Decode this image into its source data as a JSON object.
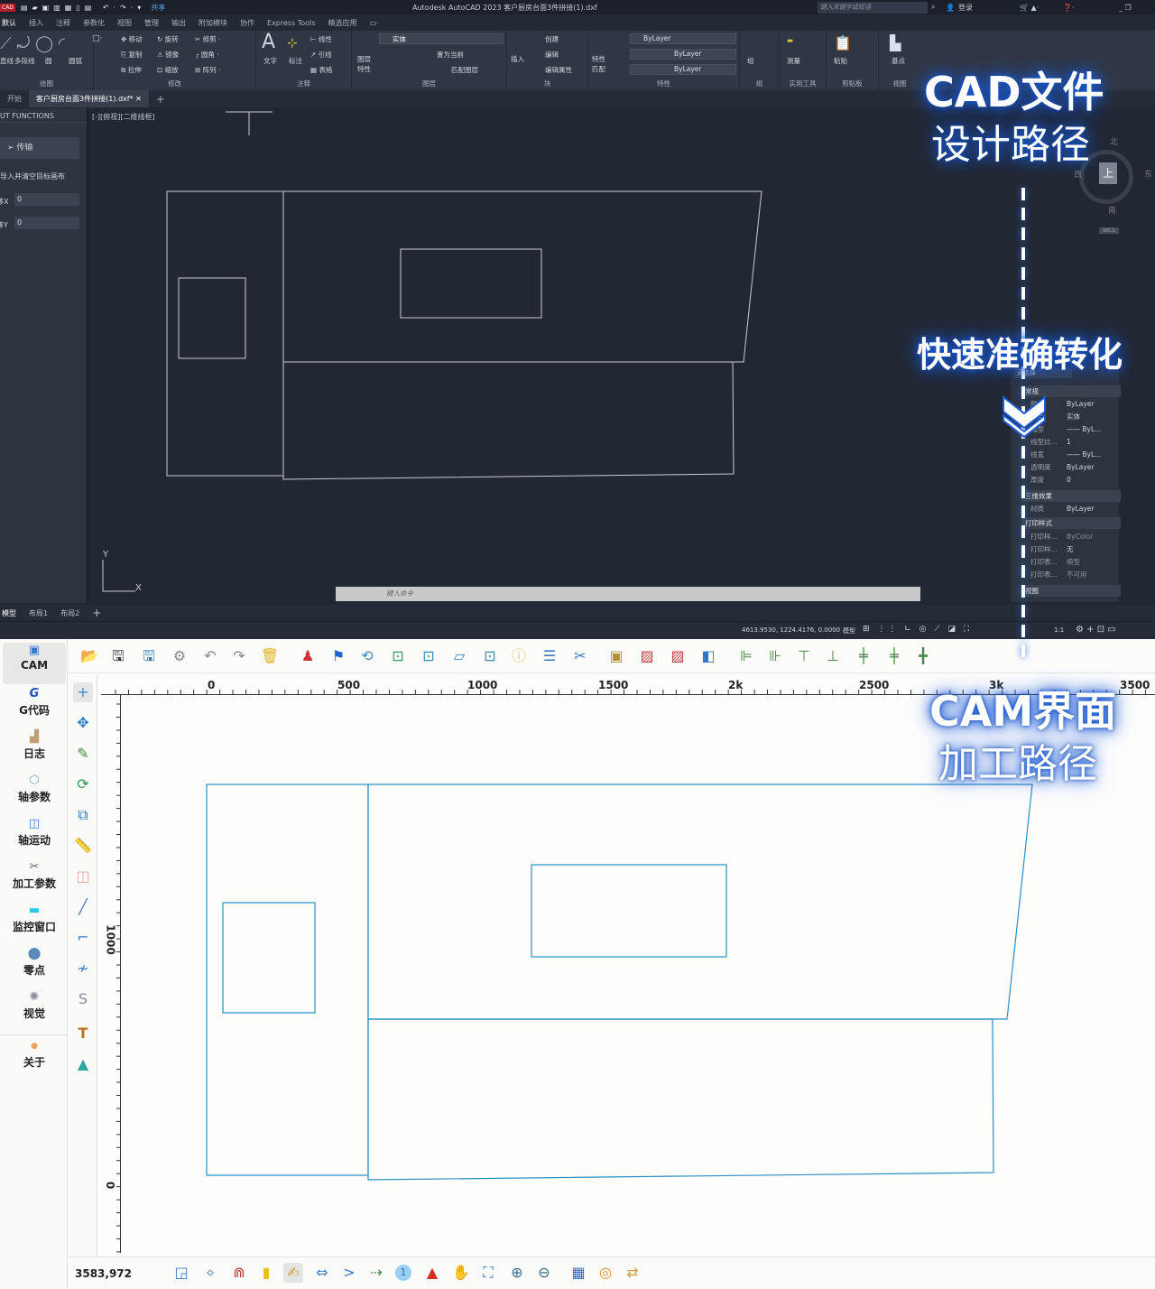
{
  "cad": {
    "app_badge": "CAD",
    "share_label": "共享",
    "window_title": "Autodesk AutoCAD 2023    客户厨房台面3件拼接(1).dxf",
    "search_placeholder": "键入关键字或短语",
    "login_label": "登录",
    "menu_tabs": [
      "默认",
      "插入",
      "注释",
      "参数化",
      "视图",
      "管理",
      "输出",
      "附加模块",
      "协作",
      "Express Tools",
      "精选应用"
    ],
    "ribbon": {
      "draw": {
        "label": "绘图",
        "items": [
          "直线",
          "多段线",
          "圆",
          "圆弧"
        ]
      },
      "modify": {
        "label": "修改",
        "items": [
          "移动",
          "旋转",
          "修剪",
          "复制",
          "镜像",
          "圆角",
          "拉伸",
          "缩放",
          "阵列"
        ]
      },
      "annotation": {
        "label": "注释",
        "items": [
          "文字",
          "标注",
          "线性",
          "引线",
          "表格"
        ]
      },
      "layers": {
        "label": "图层",
        "items": [
          "图层特性",
          "置为当前",
          "匹配图层"
        ],
        "layer_value": "实体"
      },
      "block": {
        "label": "块",
        "items": [
          "插入",
          "创建",
          "编辑",
          "编辑属性"
        ]
      },
      "properties": {
        "label": "特性",
        "items": [
          "特性匹配"
        ],
        "color": "ByLayer",
        "linetype": "ByLayer",
        "lineweight": "ByLayer"
      },
      "groups": {
        "label": "组",
        "items": [
          "组"
        ]
      },
      "utilities": {
        "label": "实用工具",
        "items": [
          "测量"
        ]
      },
      "clipboard": {
        "label": "剪贴板",
        "items": [
          "粘贴"
        ]
      },
      "view": {
        "label": "视图",
        "items": [
          "基点"
        ]
      }
    },
    "doc_tabs": [
      "开始",
      "客户厨房台面3件拼接(1).dxf*"
    ],
    "left_panel": {
      "title": "UT FUNCTIONS",
      "transfer_button": "传输",
      "import_label": "导入并清空目标画布",
      "offset_x_label": "移X",
      "offset_x": "0",
      "offset_y_label": "移Y",
      "offset_y": "0"
    },
    "viewport_label": "[-][俯视][二维线框]",
    "viewcube": {
      "top": "上",
      "north": "北",
      "south": "南",
      "east": "东",
      "west": "西",
      "wcs": "WCS"
    },
    "properties": {
      "selection": "无选择",
      "sections": [
        "常规",
        "三维效果",
        "打印样式",
        "视图"
      ],
      "rows": [
        {
          "label": "颜色",
          "value": "ByLayer"
        },
        {
          "label": "图层",
          "value": "实体"
        },
        {
          "label": "线型",
          "value": "—— ByL..."
        },
        {
          "label": "线型比...",
          "value": "1"
        },
        {
          "label": "线宽",
          "value": "—— ByL..."
        },
        {
          "label": "透明度",
          "value": "ByLayer"
        },
        {
          "label": "厚度",
          "value": "0"
        },
        {
          "label": "材质",
          "value": "ByLayer"
        },
        {
          "label": "打印样...",
          "value": "ByColor"
        },
        {
          "label": "打印样...",
          "value": "无"
        },
        {
          "label": "打印表...",
          "value": "模型"
        },
        {
          "label": "打印表...",
          "value": "不可用"
        }
      ]
    },
    "command_placeholder": "键入命令",
    "layout_tabs": [
      "模型",
      "布局1",
      "布局2"
    ],
    "coordinates": "4613.9530, 1224.4176, 0.0000",
    "model_label": "模型",
    "scale": "1:1"
  },
  "cam": {
    "nav": [
      {
        "label": "CAM",
        "icon": "monitor-icon"
      },
      {
        "label": "G代码",
        "icon": "g-code-icon"
      },
      {
        "label": "日志",
        "icon": "log-icon"
      },
      {
        "label": "轴参数",
        "icon": "axis-params-icon"
      },
      {
        "label": "轴运动",
        "icon": "axis-motion-icon"
      },
      {
        "label": "加工参数",
        "icon": "tools-icon"
      },
      {
        "label": "监控窗口",
        "icon": "monitor-window-icon"
      },
      {
        "label": "零点",
        "icon": "zero-point-icon"
      },
      {
        "label": "视觉",
        "icon": "vision-icon"
      },
      {
        "label": "关于",
        "icon": "info-icon"
      }
    ],
    "ruler_x": [
      "0",
      "500",
      "1000",
      "1500",
      "2k",
      "2500",
      "3k",
      "3500"
    ],
    "ruler_y": [
      "1000",
      "0"
    ],
    "cursor_coords": "3583,972",
    "layer_badge": "1",
    "accent_color": "#2a8fc4"
  },
  "overlay": {
    "cad_title": "CAD文件",
    "cad_subtitle": "设计路径",
    "middle": "快速准确转化",
    "cam_title": "CAM界面",
    "cam_subtitle": "加工路径"
  }
}
